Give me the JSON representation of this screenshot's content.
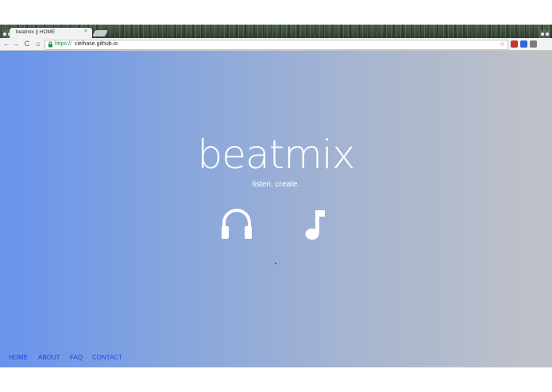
{
  "browser": {
    "tab_title": "beatmix || HOME",
    "tab_close": "×",
    "url_scheme": "https://",
    "url_host": "cielhase.github.io",
    "star": "☆",
    "back": "←",
    "forward": "→",
    "reload": "C",
    "home": "⌂",
    "lock": "🔒"
  },
  "hero": {
    "title": "beatmix",
    "subtitle": "listen. create."
  },
  "nav": {
    "home": "HOME",
    "about": "ABOUT",
    "faq": "FAQ",
    "contact": "CONTACT"
  },
  "colors": {
    "gradient_left": "#6894ec",
    "gradient_right": "#c0c2c8",
    "link": "#2f3de0"
  }
}
